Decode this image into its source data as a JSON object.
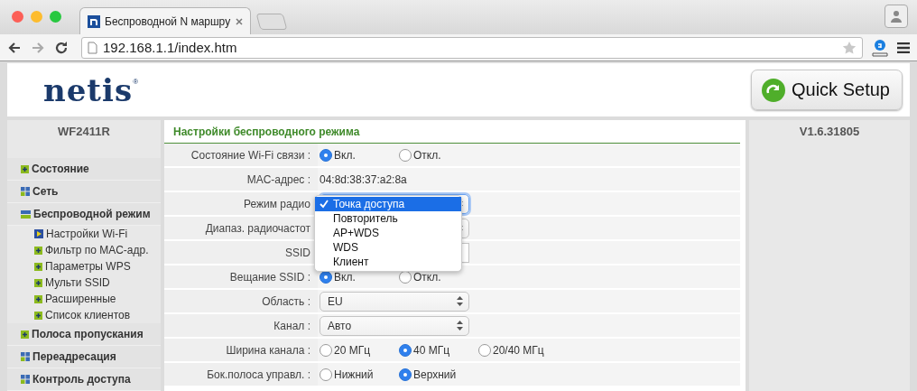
{
  "browser": {
    "tab": {
      "title": "Беспроводной N маршру"
    },
    "url": "192.168.1.1/index.htm"
  },
  "header": {
    "logo": "netis",
    "logo_mark": "®",
    "quick_setup": "Quick Setup"
  },
  "sidebar": {
    "model": "WF2411R",
    "items": [
      {
        "label": "Состояние",
        "kind": "leaf",
        "expanded": false
      },
      {
        "label": "Сеть",
        "kind": "group",
        "expanded": false
      },
      {
        "label": "Беспроводной режим",
        "kind": "group",
        "expanded": true,
        "children": [
          {
            "label": "Настройки Wi-Fi",
            "selected": true
          },
          {
            "label": "Фильтр по MAC-адр.",
            "selected": false
          },
          {
            "label": "Параметры WPS",
            "selected": false
          },
          {
            "label": "Мульти SSID",
            "selected": false
          },
          {
            "label": "Расширенные",
            "selected": false
          },
          {
            "label": "Список клиентов",
            "selected": false
          }
        ]
      },
      {
        "label": "Полоса пропускания",
        "kind": "leaf",
        "expanded": false
      },
      {
        "label": "Переадресация",
        "kind": "group",
        "expanded": false
      },
      {
        "label": "Контроль доступа",
        "kind": "group",
        "expanded": false
      }
    ]
  },
  "form": {
    "title": "Настройки беспроводного режима",
    "rows": [
      {
        "label": "Состояние Wi-Fi связи :",
        "kind": "radio",
        "options": [
          {
            "label": "Вкл.",
            "selected": true
          },
          {
            "label": "Откл.",
            "selected": false
          }
        ]
      },
      {
        "label": "MAC-адрес :",
        "kind": "text",
        "value": "04:8d:38:37:a2:8a"
      },
      {
        "label": "Режим радио",
        "kind": "select",
        "focused": true
      },
      {
        "label": "Диапаз. радиочастот",
        "kind": "select",
        "focused": false
      },
      {
        "label": "SSID",
        "kind": "input"
      },
      {
        "label": "Вещание SSID :",
        "kind": "radio",
        "options": [
          {
            "label": "Вкл.",
            "selected": true
          },
          {
            "label": "Откл.",
            "selected": false
          }
        ]
      },
      {
        "label": "Область :",
        "kind": "select",
        "focused": false,
        "value": "EU"
      },
      {
        "label": "Канал :",
        "kind": "select",
        "focused": false,
        "value": "Авто"
      },
      {
        "label": "Ширина канала :",
        "kind": "radio",
        "options": [
          {
            "label": "20 МГц",
            "selected": false
          },
          {
            "label": "40 МГц",
            "selected": true
          },
          {
            "label": "20/40 МГц",
            "selected": false
          }
        ]
      },
      {
        "label": "Бок.полоса управл. :",
        "kind": "radio",
        "options": [
          {
            "label": "Нижний",
            "selected": false
          },
          {
            "label": "Верхний",
            "selected": true
          }
        ]
      }
    ]
  },
  "dropdown": {
    "options": [
      {
        "label": "Точка доступа",
        "selected": true
      },
      {
        "label": "Повторитель",
        "selected": false
      },
      {
        "label": "AP+WDS",
        "selected": false
      },
      {
        "label": "WDS",
        "selected": false
      },
      {
        "label": "Клиент",
        "selected": false
      }
    ]
  },
  "version": "V1.6.31805"
}
